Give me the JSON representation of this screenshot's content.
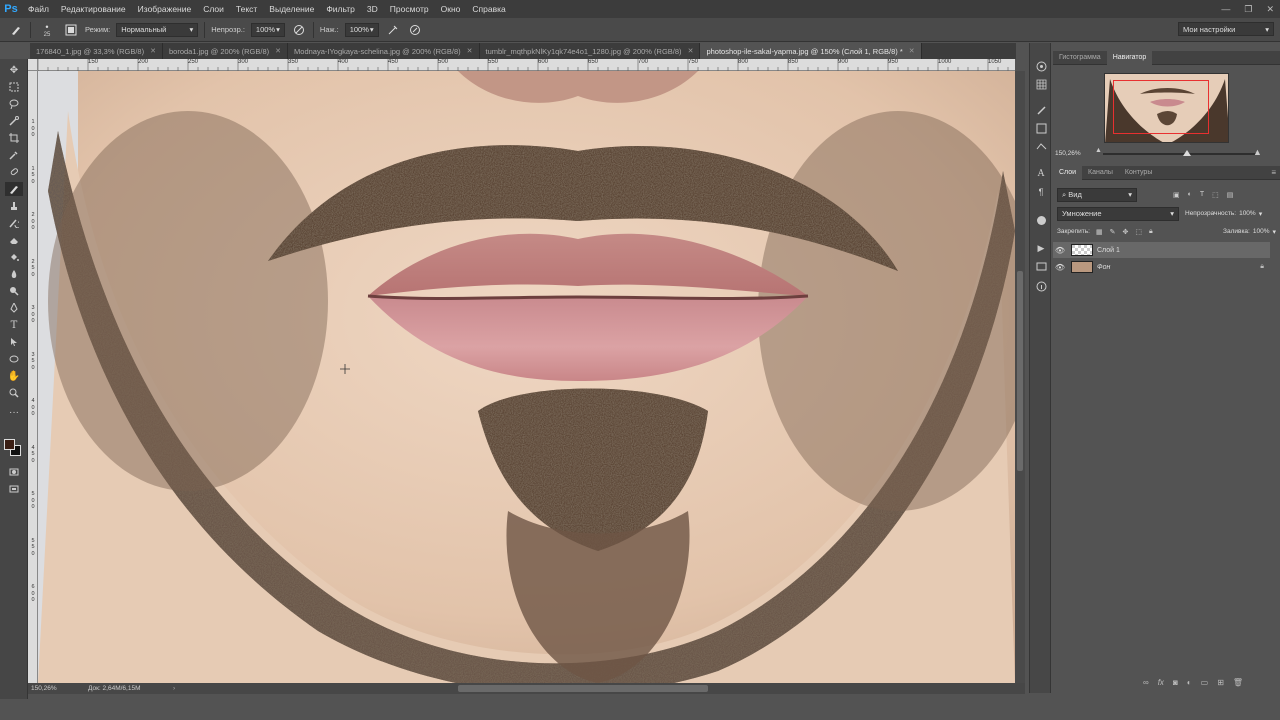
{
  "app": {
    "logo": "Ps"
  },
  "menu": [
    "Файл",
    "Редактирование",
    "Изображение",
    "Слои",
    "Текст",
    "Выделение",
    "Фильтр",
    "3D",
    "Просмотр",
    "Окно",
    "Справка"
  ],
  "window_controls": [
    "—",
    "❐",
    "✕"
  ],
  "options": {
    "brush_size": "25",
    "mode_label": "Режим:",
    "mode_value": "Нормальный",
    "opacity_label": "Непрозр.:",
    "opacity_value": "100%",
    "flow_label": "Наж.:",
    "flow_value": "100%",
    "workspace": "Мои настройки"
  },
  "tabs": [
    {
      "label": "176840_1.jpg @ 33,3% (RGB/8)",
      "active": false
    },
    {
      "label": "boroda1.jpg @ 200% (RGB/8)",
      "active": false
    },
    {
      "label": "Modnaya-IYogkaya-schelina.jpg @ 200% (RGB/8)",
      "active": false
    },
    {
      "label": "tumblr_mqthpkNlKy1qk74e4o1_1280.jpg @ 200% (RGB/8)",
      "active": false
    },
    {
      "label": "photoshop-ile-sakal-yapma.jpg @ 150% (Слой 1, RGB/8) *",
      "active": true
    }
  ],
  "ruler_h": [
    "150",
    "200",
    "250",
    "300",
    "350",
    "400",
    "450",
    "500",
    "550",
    "600",
    "650",
    "700",
    "750",
    "800",
    "850",
    "900",
    "950",
    "1000",
    "1050"
  ],
  "ruler_v": [
    "1",
    "0",
    "0",
    "1",
    "5",
    "0",
    "2",
    "0",
    "0",
    "2",
    "5",
    "0",
    "3",
    "0",
    "0",
    "3",
    "5",
    "0",
    "4",
    "0",
    "0",
    "4",
    "5",
    "0",
    "5",
    "0",
    "0",
    "5",
    "5",
    "0",
    "6",
    "0",
    "0"
  ],
  "status": {
    "zoom": "150,26%",
    "doc": "Док: 2,64M/6,15M"
  },
  "navigator": {
    "tabs": [
      {
        "label": "Гистограмма",
        "active": false
      },
      {
        "label": "Навигатор",
        "active": true
      }
    ],
    "zoom": "150,26%"
  },
  "layers_panel": {
    "tabs": [
      {
        "label": "Слои",
        "active": true
      },
      {
        "label": "Каналы",
        "active": false
      },
      {
        "label": "Контуры",
        "active": false
      }
    ],
    "filter": "Вид",
    "blend_mode": "Умножение",
    "opacity_label": "Непрозрачность:",
    "opacity_value": "100%",
    "lock_label": "Закрепить:",
    "fill_label": "Заливка:",
    "fill_value": "100%",
    "layers": [
      {
        "name": "Слой 1",
        "selected": true
      },
      {
        "name": "Фон",
        "selected": false
      }
    ]
  },
  "colors": {
    "accent": "#31a8ff",
    "nav_box": "#e83030"
  }
}
